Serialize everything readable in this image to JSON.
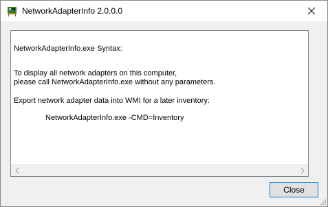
{
  "window": {
    "title": "NetworkAdapterInfo 2.0.0.0",
    "icon": "network-adapter-card-icon"
  },
  "content": {
    "lines": [
      "NetworkAdapterInfo.exe Syntax:",
      "To display all network adapters on this computer,",
      "please call NetworkAdapterInfo.exe without any parameters.",
      "Export network adapter data into WMI for a later inventory:",
      "NetworkAdapterInfo.exe -CMD=Inventory"
    ]
  },
  "buttons": {
    "close_label": "Close"
  }
}
